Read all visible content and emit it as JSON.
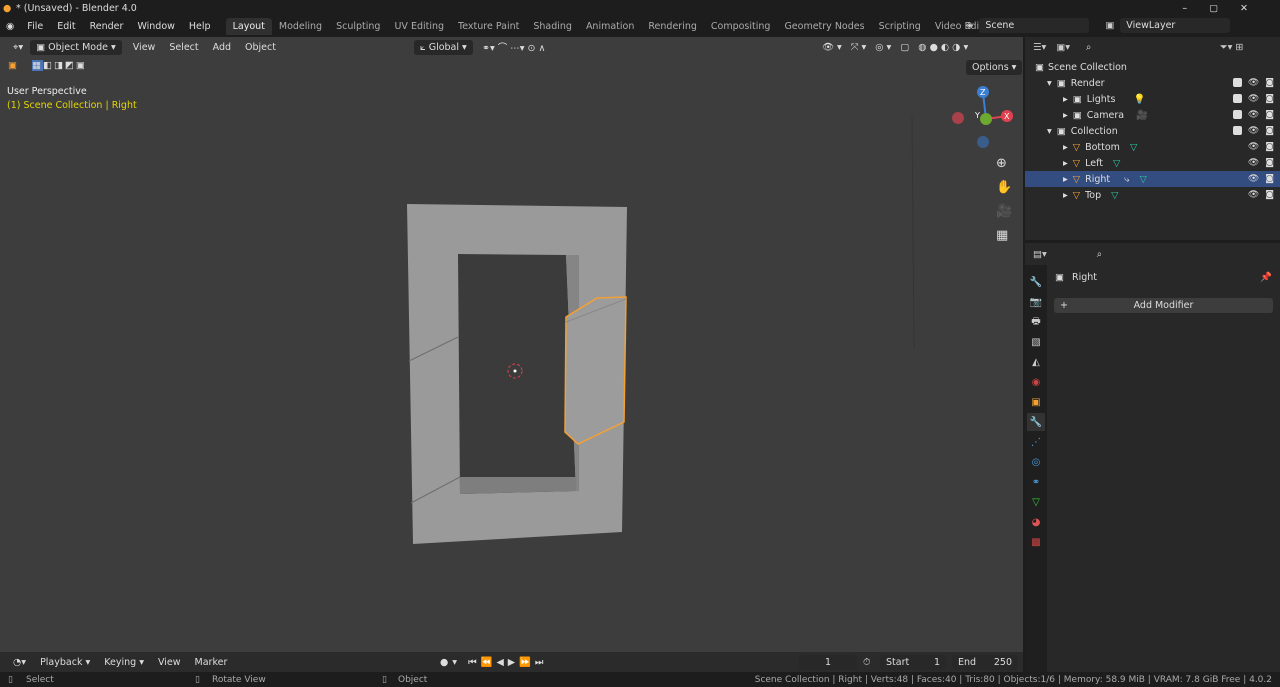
{
  "window": {
    "title": "* (Unsaved) - Blender 4.0"
  },
  "menu": [
    "File",
    "Edit",
    "Render",
    "Window",
    "Help"
  ],
  "workspaces": [
    {
      "label": "Layout",
      "active": true
    },
    {
      "label": "Modeling"
    },
    {
      "label": "Sculpting"
    },
    {
      "label": "UV Editing"
    },
    {
      "label": "Texture Paint"
    },
    {
      "label": "Shading"
    },
    {
      "label": "Animation"
    },
    {
      "label": "Rendering"
    },
    {
      "label": "Compositing"
    },
    {
      "label": "Geometry Nodes"
    },
    {
      "label": "Scripting"
    },
    {
      "label": "Video Editing"
    }
  ],
  "scene": "Scene",
  "view_layer": "ViewLayer",
  "viewport": {
    "mode": "Object Mode",
    "menus": [
      "View",
      "Select",
      "Add",
      "Object"
    ],
    "orientation": "Global",
    "options": "Options",
    "perspective": "User Perspective",
    "context": "(1) Scene Collection | Right",
    "axes": {
      "z": "Z",
      "y": "Y",
      "x": "X"
    }
  },
  "outliner": {
    "root": "Scene Collection",
    "items": [
      {
        "label": "Render",
        "depth": 1,
        "type": "collection"
      },
      {
        "label": "Lights",
        "depth": 2,
        "type": "object",
        "extra": "light"
      },
      {
        "label": "Camera",
        "depth": 2,
        "type": "object",
        "extra": "camera"
      },
      {
        "label": "Collection",
        "depth": 1,
        "type": "collection"
      },
      {
        "label": "Bottom",
        "depth": 2,
        "type": "mesh"
      },
      {
        "label": "Left",
        "depth": 2,
        "type": "mesh"
      },
      {
        "label": "Right",
        "depth": 2,
        "type": "mesh",
        "selected": true
      },
      {
        "label": "Top",
        "depth": 2,
        "type": "mesh"
      }
    ]
  },
  "properties": {
    "object": "Right",
    "add_modifier": "Add Modifier"
  },
  "timeline": {
    "menus": [
      "Playback",
      "Keying",
      "View",
      "Marker"
    ],
    "current_frame": "1",
    "start_label": "Start",
    "start": "1",
    "end_label": "End",
    "end": "250"
  },
  "status": {
    "select": "Select",
    "rotate": "Rotate View",
    "object": "Object",
    "info": "Scene Collection | Right | Verts:48 | Faces:40 | Tris:80 | Objects:1/6 | Memory: 58.9 MiB | VRAM: 7.8 GiB Free | 4.0.2"
  },
  "colors": {
    "selection": "#f5a033",
    "context_text": "#e6d600",
    "selected_row": "#334d80",
    "x_axis": "#e0414e",
    "y_axis": "#6da830",
    "z_axis": "#3b7fd4"
  }
}
